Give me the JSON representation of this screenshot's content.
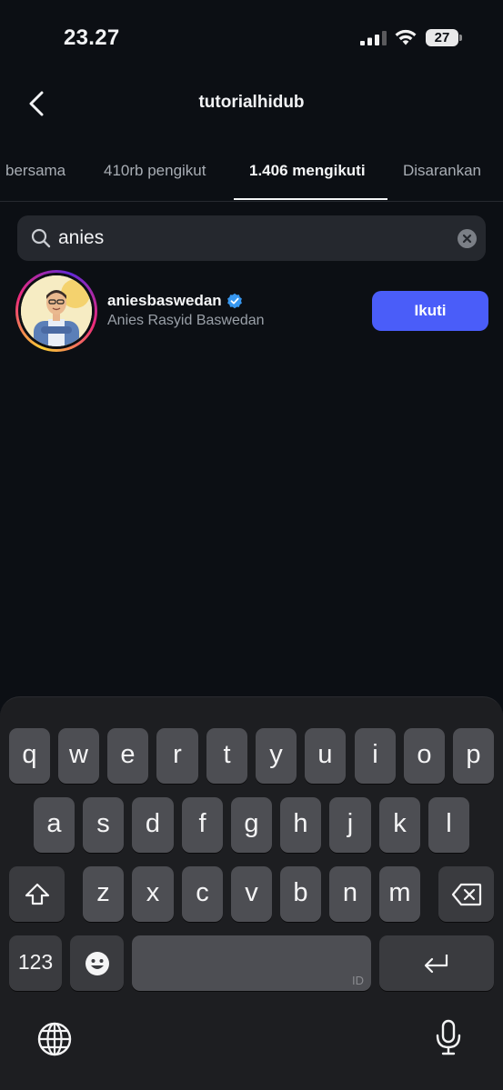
{
  "status_bar": {
    "time": "23.27",
    "battery": "27"
  },
  "header": {
    "title": "tutorialhidub"
  },
  "tabs": [
    {
      "label": "bersama",
      "active": false
    },
    {
      "label": "410rb pengikut",
      "active": false
    },
    {
      "label": "1.406 mengikuti",
      "active": true
    },
    {
      "label": "Disarankan",
      "active": false
    }
  ],
  "search": {
    "value": "anies"
  },
  "result": {
    "username": "aniesbaswedan",
    "full_name": "Anies Rasyid Baswedan",
    "verified": true,
    "follow_label": "Ikuti"
  },
  "keyboard": {
    "row1": [
      "q",
      "w",
      "e",
      "r",
      "t",
      "y",
      "u",
      "i",
      "o",
      "p"
    ],
    "row2": [
      "a",
      "s",
      "d",
      "f",
      "g",
      "h",
      "j",
      "k",
      "l"
    ],
    "row3": [
      "z",
      "x",
      "c",
      "v",
      "b",
      "n",
      "m"
    ],
    "numbers_label": "123",
    "space_language": "ID"
  },
  "colors": {
    "accent": "#4a5df9",
    "background": "#0c0f14",
    "verified": "#3797f0"
  }
}
